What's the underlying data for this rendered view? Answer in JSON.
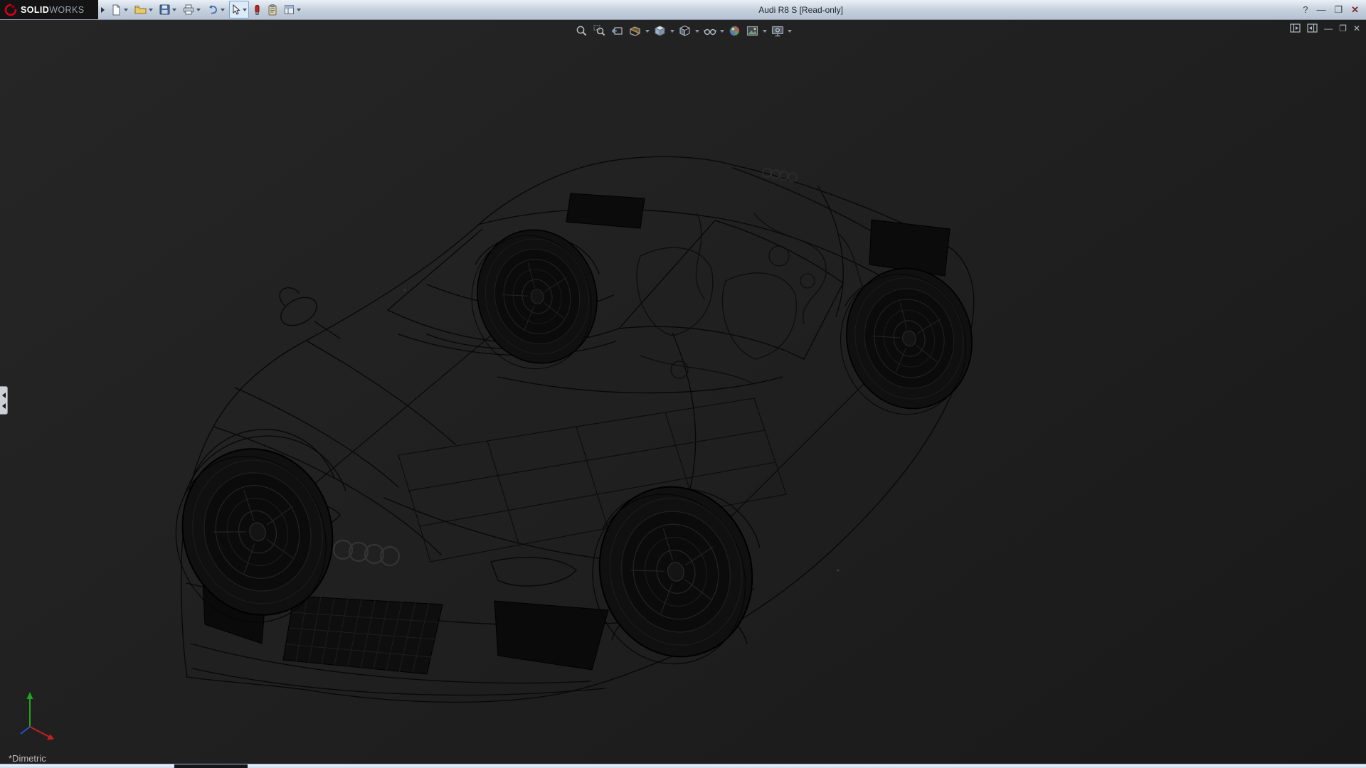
{
  "window": {
    "brand_bold": "SOLID",
    "brand_light": "WORKS",
    "title": "Audi R8 S [Read-only]",
    "controls": {
      "help": "?",
      "minimize": "—",
      "maximize": "❐",
      "close": "✕"
    }
  },
  "toolbar": {
    "items": [
      {
        "id": "new",
        "icon": "new-document-icon",
        "dropdown": true
      },
      {
        "id": "open",
        "icon": "open-folder-icon",
        "dropdown": true
      },
      {
        "id": "save",
        "icon": "save-icon",
        "dropdown": true
      },
      {
        "id": "print",
        "icon": "print-icon",
        "dropdown": true
      },
      {
        "id": "undo",
        "icon": "undo-icon",
        "dropdown": true
      },
      {
        "id": "select",
        "icon": "select-cursor-icon",
        "dropdown": true,
        "active": true
      },
      {
        "id": "appearance",
        "icon": "appearance-icon",
        "dropdown": false
      },
      {
        "id": "clipboard",
        "icon": "clipboard-icon",
        "dropdown": false
      },
      {
        "id": "options",
        "icon": "options-icon",
        "dropdown": true
      }
    ]
  },
  "viewport": {
    "hud_items": [
      {
        "id": "zoom-to-fit",
        "icon": "magnifier-icon",
        "dropdown": false
      },
      {
        "id": "zoom-to-area",
        "icon": "magnifier-area-icon",
        "dropdown": false
      },
      {
        "id": "previous-view",
        "icon": "previous-view-icon",
        "dropdown": false
      },
      {
        "id": "section-view",
        "icon": "section-cube-icon",
        "dropdown": true
      },
      {
        "id": "view-orientation",
        "icon": "orientation-cube-icon",
        "dropdown": true
      },
      {
        "id": "display-style",
        "icon": "display-style-icon",
        "dropdown": true
      },
      {
        "id": "hide-show-items",
        "icon": "eyeglasses-icon",
        "dropdown": true
      },
      {
        "id": "edit-appearance",
        "icon": "color-sphere-icon",
        "dropdown": false
      },
      {
        "id": "apply-scene",
        "icon": "scene-icon",
        "dropdown": true
      },
      {
        "id": "view-settings",
        "icon": "view-settings-icon",
        "dropdown": true
      }
    ],
    "window_controls": {
      "minimize": "—",
      "restore": "❐",
      "close": "✕"
    }
  },
  "status": {
    "view_label": "*Dimetric"
  },
  "colors": {
    "titlebar": "#c6d1de",
    "viewport_bg": "#1f1f1f",
    "logo_red": "#d6001c",
    "select_active_bg": "#dcebf8",
    "wireframe": "#070707"
  }
}
